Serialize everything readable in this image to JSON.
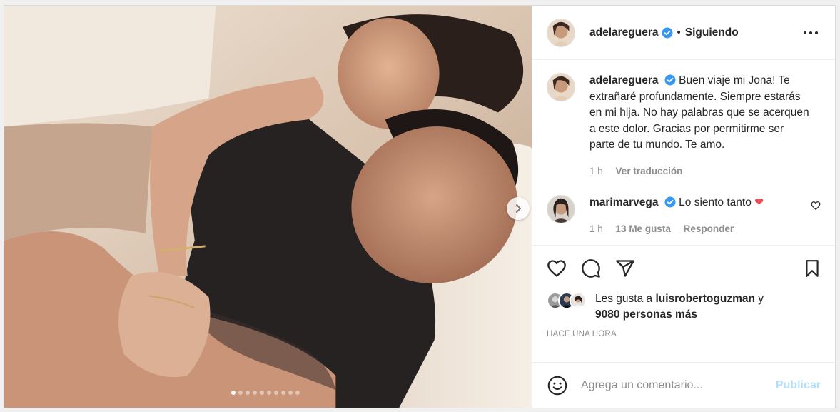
{
  "post": {
    "username": "adelareguera",
    "follow_status": "Siguiendo",
    "bullet": "•"
  },
  "caption": {
    "username": "adelareguera",
    "text": "Buen viaje mi Jona! Te extrañaré profundamente. Siempre estarás en mi hija. No hay palabras que se acerquen a este dolor. Gracias por permitirme ser parte de tu mundo. Te amo.",
    "time": "1 h",
    "translate": "Ver traducción"
  },
  "reply": {
    "username": "marimarvega",
    "text": "Lo siento tanto",
    "emoji": "❤",
    "time": "1 h",
    "likes": "13 Me gusta",
    "reply_label": "Responder"
  },
  "likes": {
    "prefix": "Les gusta a ",
    "user": "luisrobertoguzman",
    "joiner": " y",
    "others": "9080 personas más"
  },
  "time_ago": "HACE UNA HORA",
  "compose": {
    "placeholder": "Agrega un comentario...",
    "publish_label": "Publicar"
  },
  "carousel": {
    "total_slides": 10,
    "current_slide": 1
  },
  "icons": {
    "verified": "verified-badge-icon",
    "more": "more-options-icon",
    "like": "heart-outline-icon",
    "comment": "comment-bubble-icon",
    "share": "paper-plane-icon",
    "save": "bookmark-icon",
    "emoji": "smiley-icon",
    "next": "chevron-right-icon"
  },
  "colors": {
    "verified_blue": "#3897f0",
    "heart_red": "#ed4956",
    "publish_disabled": "#b2dffc",
    "muted_text": "#8e8e8e"
  }
}
